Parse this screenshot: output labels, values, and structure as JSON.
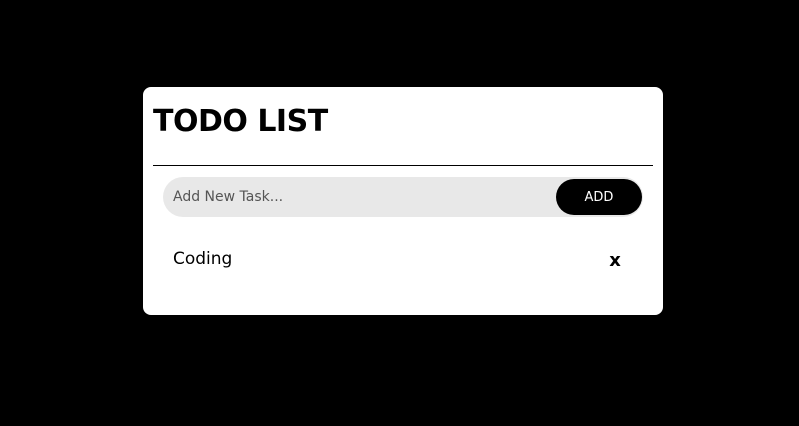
{
  "app": {
    "title": "TODO LIST"
  },
  "input": {
    "placeholder": "Add New Task...",
    "value": ""
  },
  "add_button": {
    "label": "ADD"
  },
  "tasks": [
    {
      "text": "Coding",
      "delete_label": "x"
    }
  ],
  "colors": {
    "background": "#000000",
    "card": "#ffffff",
    "input_background": "#e8e8e8",
    "button_background": "#000000",
    "button_text": "#ffffff"
  }
}
